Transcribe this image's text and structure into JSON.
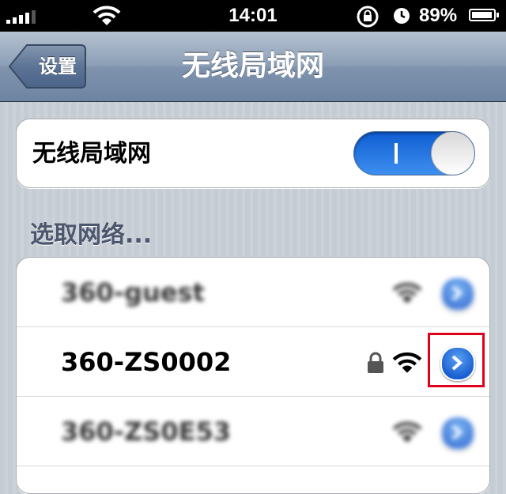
{
  "status_bar": {
    "time": "14:01",
    "battery_percent": "89%",
    "battery_level": 0.89,
    "signal_bars": 4
  },
  "nav": {
    "back_label": "设置",
    "title": "无线局域网"
  },
  "wifi_toggle": {
    "label": "无线局域网",
    "state": "on"
  },
  "section_header": "选取网络...",
  "networks": [
    {
      "name": "360-guest",
      "locked": false
    },
    {
      "name": "360-ZS0002",
      "locked": true
    },
    {
      "name": "360-ZS0E53",
      "locked": false
    }
  ],
  "colors": {
    "accent_blue": "#2f80ea",
    "highlight_red": "#e0001b"
  }
}
